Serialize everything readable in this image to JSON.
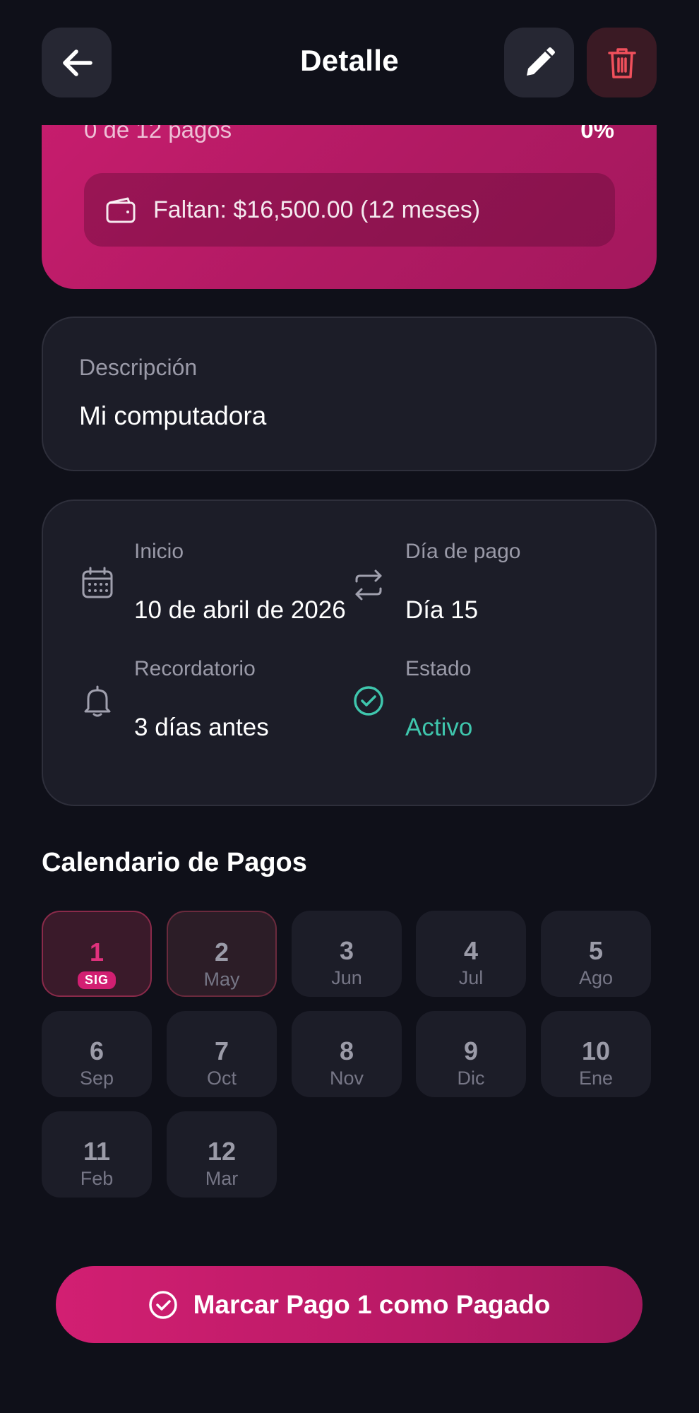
{
  "header": {
    "title": "Detalle",
    "back_icon": "arrow-left-icon",
    "edit_icon": "pencil-icon",
    "delete_icon": "trash-icon"
  },
  "summary": {
    "progress_text": "0 de 12 pagos",
    "progress_percent": "0%",
    "progress_fraction": 0,
    "remaining_text": "Faltan: $16,500.00 (12 meses)",
    "wallet_icon": "wallet-icon",
    "card_color": "#c81d6e"
  },
  "description": {
    "label": "Descripción",
    "value": "Mi computadora"
  },
  "info": {
    "start": {
      "label": "Inicio",
      "value": "10 de abril de 2026",
      "icon": "calendar-icon"
    },
    "pay_day": {
      "label": "Día de pago",
      "value": "Día 15",
      "icon": "repeat-icon"
    },
    "reminder": {
      "label": "Recordatorio",
      "value": "3 días antes",
      "icon": "bell-icon"
    },
    "status": {
      "label": "Estado",
      "value": "Activo",
      "icon": "check-circle-icon",
      "color": "#3fc6ad"
    }
  },
  "calendar": {
    "title": "Calendario de Pagos",
    "payments": [
      {
        "number": "1",
        "month": "",
        "badge": "SIG",
        "state": "next"
      },
      {
        "number": "2",
        "month": "May",
        "state": "upcoming"
      },
      {
        "number": "3",
        "month": "Jun",
        "state": "pending"
      },
      {
        "number": "4",
        "month": "Jul",
        "state": "pending"
      },
      {
        "number": "5",
        "month": "Ago",
        "state": "pending"
      },
      {
        "number": "6",
        "month": "Sep",
        "state": "pending"
      },
      {
        "number": "7",
        "month": "Oct",
        "state": "pending"
      },
      {
        "number": "8",
        "month": "Nov",
        "state": "pending"
      },
      {
        "number": "9",
        "month": "Dic",
        "state": "pending"
      },
      {
        "number": "10",
        "month": "Ene",
        "state": "pending"
      },
      {
        "number": "11",
        "month": "Feb",
        "state": "pending"
      },
      {
        "number": "12",
        "month": "Mar",
        "state": "pending"
      }
    ]
  },
  "action": {
    "label": "Marcar Pago 1 como Pagado",
    "icon": "check-circle-icon",
    "color": "#d21f72"
  }
}
